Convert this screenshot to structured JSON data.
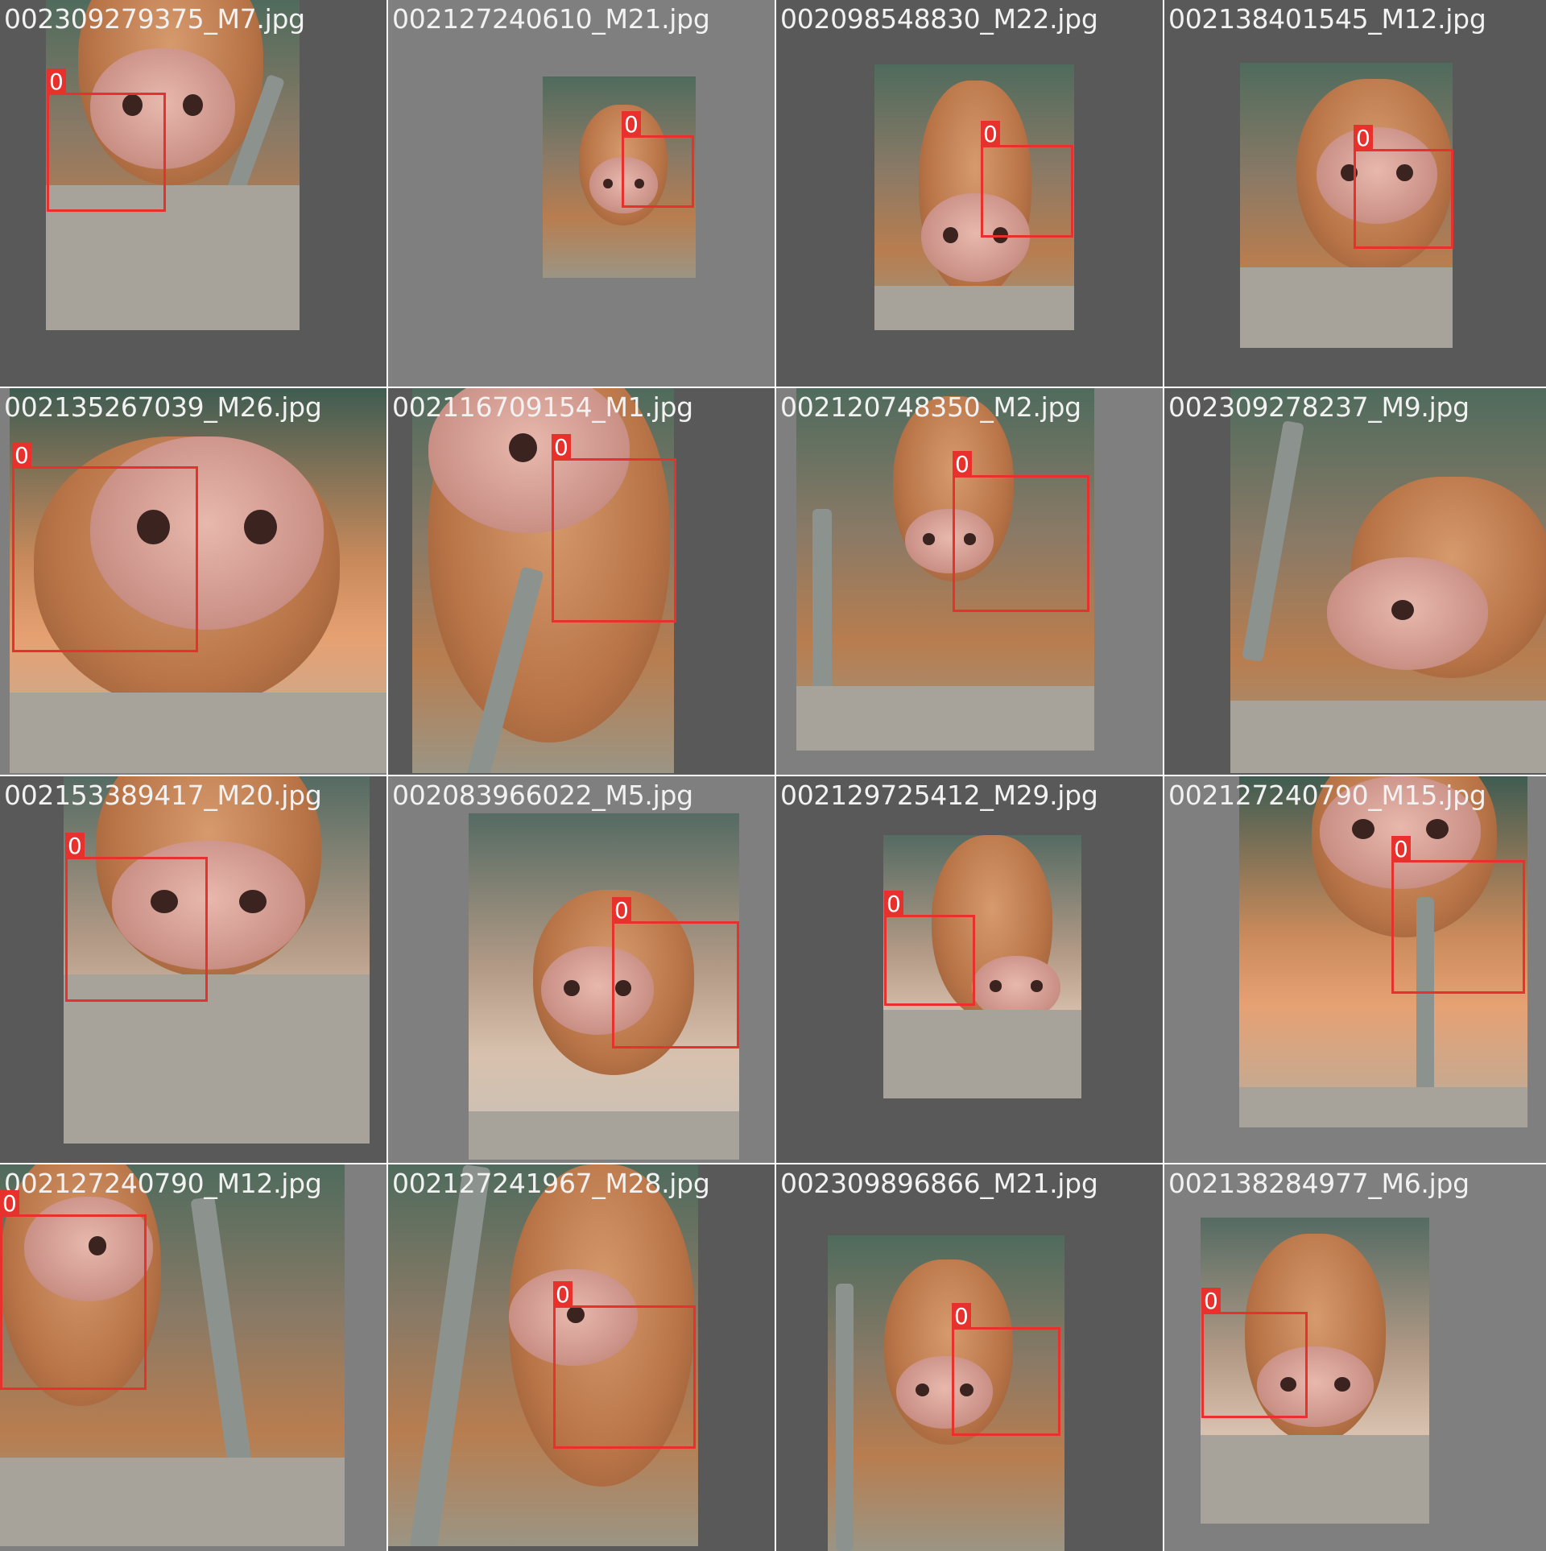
{
  "tiles": [
    {
      "filename": "002309279375_M7.jpg",
      "label": "0"
    },
    {
      "filename": "002127240610_M21.jpg",
      "label": "0"
    },
    {
      "filename": "002098548830_M22.jpg",
      "label": "0"
    },
    {
      "filename": "002138401545_M12.jpg",
      "label": "0"
    },
    {
      "filename": "002135267039_M26.jpg",
      "label": "0"
    },
    {
      "filename": "002116709154_M1.jpg",
      "label": "0"
    },
    {
      "filename": "002120748350_M2.jpg",
      "label": "0"
    },
    {
      "filename": "002309278237_M9.jpg",
      "label": ""
    },
    {
      "filename": "002153389417_M20.jpg",
      "label": "0"
    },
    {
      "filename": "002083966022_M5.jpg",
      "label": "0"
    },
    {
      "filename": "002129725412_M29.jpg",
      "label": "0"
    },
    {
      "filename": "002127240790_M15.jpg",
      "label": "0"
    },
    {
      "filename": "002127240790_M12.jpg",
      "label": "0"
    },
    {
      "filename": "002127241967_M28.jpg",
      "label": "0"
    },
    {
      "filename": "002309896866_M21.jpg",
      "label": "0"
    },
    {
      "filename": "002138284977_M6.jpg",
      "label": "0"
    }
  ],
  "colors": {
    "tile_background": "#7f7f7f",
    "tile_background_dark": "#595959",
    "bbox": "#e8302c",
    "filename_text": "#f2f2f2"
  }
}
